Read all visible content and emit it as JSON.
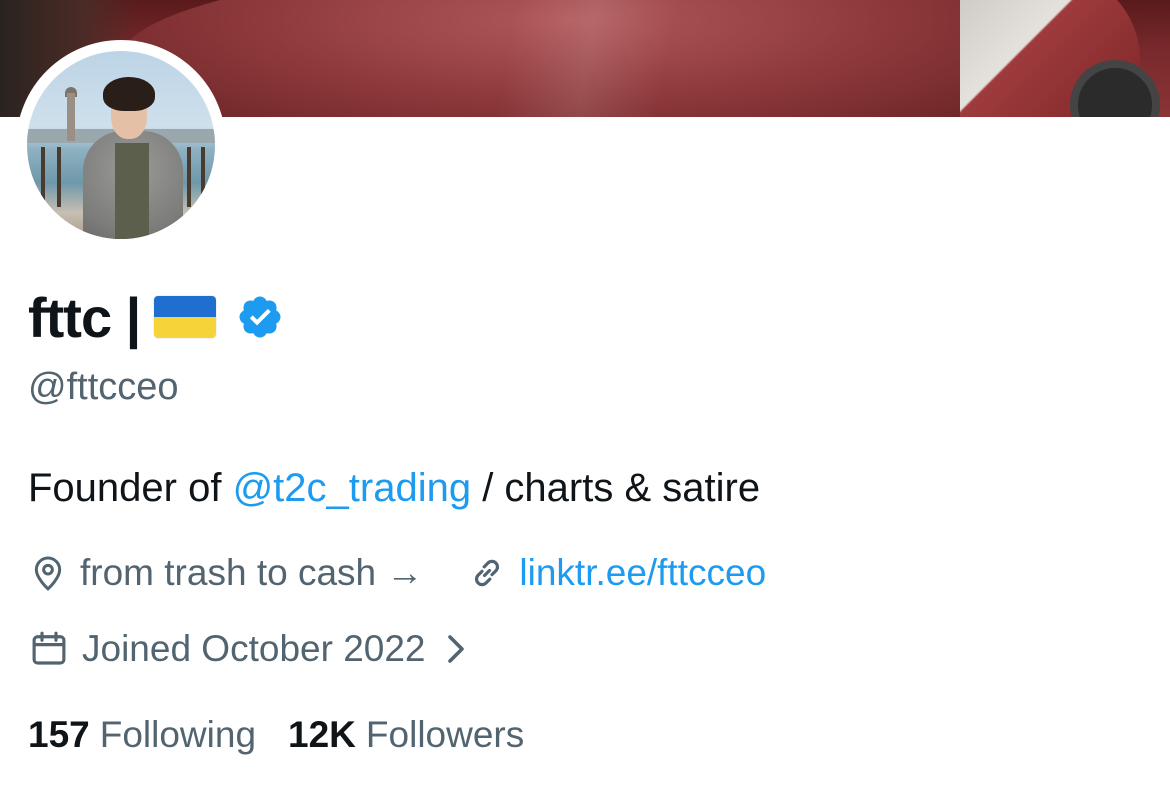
{
  "profile": {
    "display_name": "fttc |",
    "flag_emoji": "ukraine-flag",
    "verified": true,
    "handle": "@fttcceo",
    "bio": {
      "prefix": "Founder of ",
      "mention": "@t2c_trading",
      "suffix": " / charts & satire"
    },
    "location": "from trash to cash →",
    "website": "linktr.ee/fttcceo",
    "joined": "Joined October 2022",
    "following_count": "157",
    "following_label": "Following",
    "followers_count": "12K",
    "followers_label": "Followers"
  },
  "colors": {
    "accent": "#1d9bf0",
    "secondary_text": "#536471",
    "primary_text": "#0f1419",
    "verified_badge": "#1d9bf0"
  },
  "icons": {
    "location": "location-pin-icon",
    "website": "link-icon",
    "joined": "calendar-icon",
    "joined_more": "chevron-right-icon",
    "verified": "verified-badge-icon"
  }
}
